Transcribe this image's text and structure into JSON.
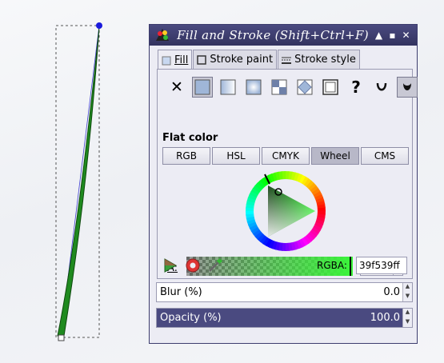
{
  "dialog": {
    "title": "Fill and Stroke (Shift+Ctrl+F)",
    "window_buttons": [
      "up-arrow-icon",
      "maximize-icon",
      "close-icon"
    ]
  },
  "tabs": [
    {
      "label": "Fill",
      "icon": "fill-icon",
      "active": true
    },
    {
      "label": "Stroke paint",
      "icon": "stroke-paint-icon",
      "active": false
    },
    {
      "label": "Stroke style",
      "icon": "stroke-style-icon",
      "active": false
    }
  ],
  "paint_types": [
    "no-paint-icon",
    "flat-color-icon",
    "linear-gradient-icon",
    "radial-gradient-icon",
    "pattern-icon",
    "swatch-icon",
    "unset-paint-icon",
    "fill-rule-evenodd-icon",
    "fill-rule-nonzero-icon"
  ],
  "flat_color": {
    "label": "Flat color",
    "modes": [
      "RGB",
      "HSL",
      "CMYK",
      "Wheel",
      "CMS"
    ],
    "selected_mode": "Wheel",
    "alpha_label": "A:",
    "alpha_value": "255",
    "rgba_label": "RGBA:",
    "rgba_value": "39f539ff",
    "color": "#39f539",
    "tools": [
      "color-managed-icon",
      "out-of-gamut-icon",
      "color-picker-icon"
    ]
  },
  "blur": {
    "label": "Blur (%)",
    "value": "0.0"
  },
  "opacity": {
    "label": "Opacity (%)",
    "value": "100.0"
  },
  "colors": {
    "titlebar": "#3d3d6e",
    "accent": "#4a4a80",
    "stroke_path": "#1a6e1a",
    "node": "#1a1adc"
  }
}
